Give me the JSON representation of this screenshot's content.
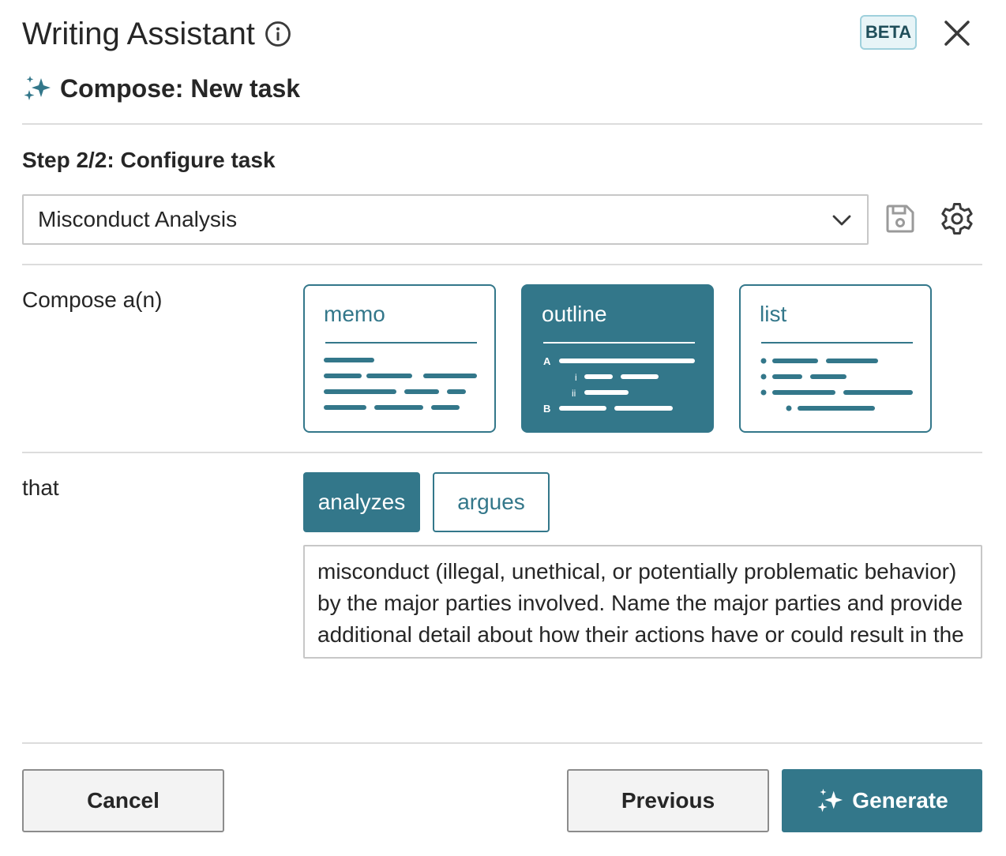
{
  "header": {
    "title": "Writing Assistant",
    "badge": "BETA",
    "subtitle": "Compose: New task"
  },
  "step": {
    "label": "Step 2/2: Configure task"
  },
  "template_select": {
    "value": "Misconduct Analysis"
  },
  "compose": {
    "label": "Compose a(n)",
    "options": [
      {
        "label": "memo",
        "selected": false
      },
      {
        "label": "outline",
        "selected": true
      },
      {
        "label": "list",
        "selected": false
      }
    ]
  },
  "that": {
    "label": "that",
    "verbs": [
      {
        "label": "analyzes",
        "selected": true
      },
      {
        "label": "argues",
        "selected": false
      }
    ],
    "prompt_text": "misconduct (illegal, unethical, or potentially problematic behavior) by the major parties involved. Name the major parties and provide additional detail about how their actions have or could result in the outcome of this case."
  },
  "outline_markers": {
    "a": "A",
    "i": "i",
    "ii": "ii",
    "b": "B"
  },
  "footer": {
    "cancel": "Cancel",
    "previous": "Previous",
    "generate": "Generate"
  },
  "colors": {
    "accent": "#33778a",
    "badge_bg": "#e7f4f7",
    "border": "#c7c7c7"
  }
}
